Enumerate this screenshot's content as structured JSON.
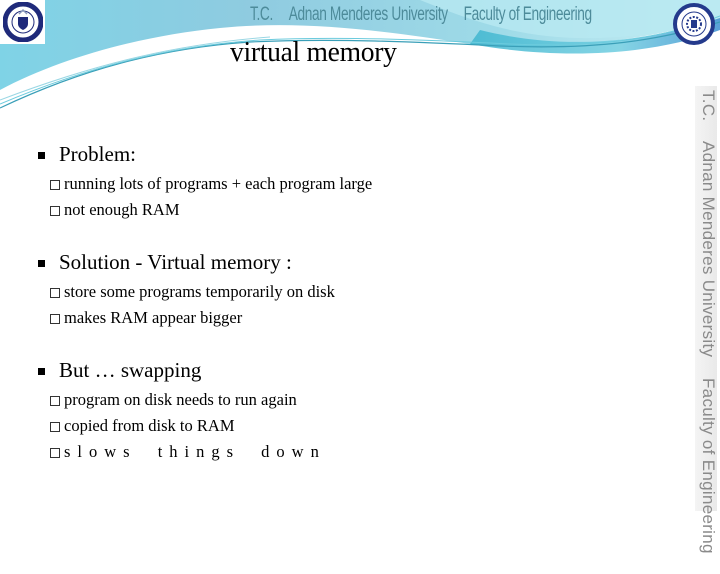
{
  "header": {
    "title_parts": [
      "T.C.",
      "Adnan Menderes University",
      "Faculty of Engineering"
    ],
    "left_logo": "university-seal-icon",
    "right_logo": "faculty-seal-icon",
    "colors": {
      "band_light": "#a9e4ee",
      "band_mid": "#6dc7dc",
      "band_dark": "#3aa3c2",
      "header_text": "#4d8b9a",
      "side_text": "#8a8a8a"
    }
  },
  "side_banner": {
    "parts": [
      "T.C.",
      "Adnan Menderes University",
      "Faculty of Engineering"
    ]
  },
  "slide": {
    "title": "virtual memory",
    "sections": [
      {
        "heading": "Problem:",
        "items": [
          "running lots of programs + each program large",
          "not enough RAM"
        ]
      },
      {
        "heading": "Solution - Virtual memory :",
        "items": [
          "store some programs temporarily on disk",
          "makes RAM appear bigger"
        ]
      },
      {
        "heading": "But … swapping",
        "items": [
          "program on disk needs to run again",
          "copied from disk to RAM",
          "slows things down"
        ]
      }
    ]
  }
}
